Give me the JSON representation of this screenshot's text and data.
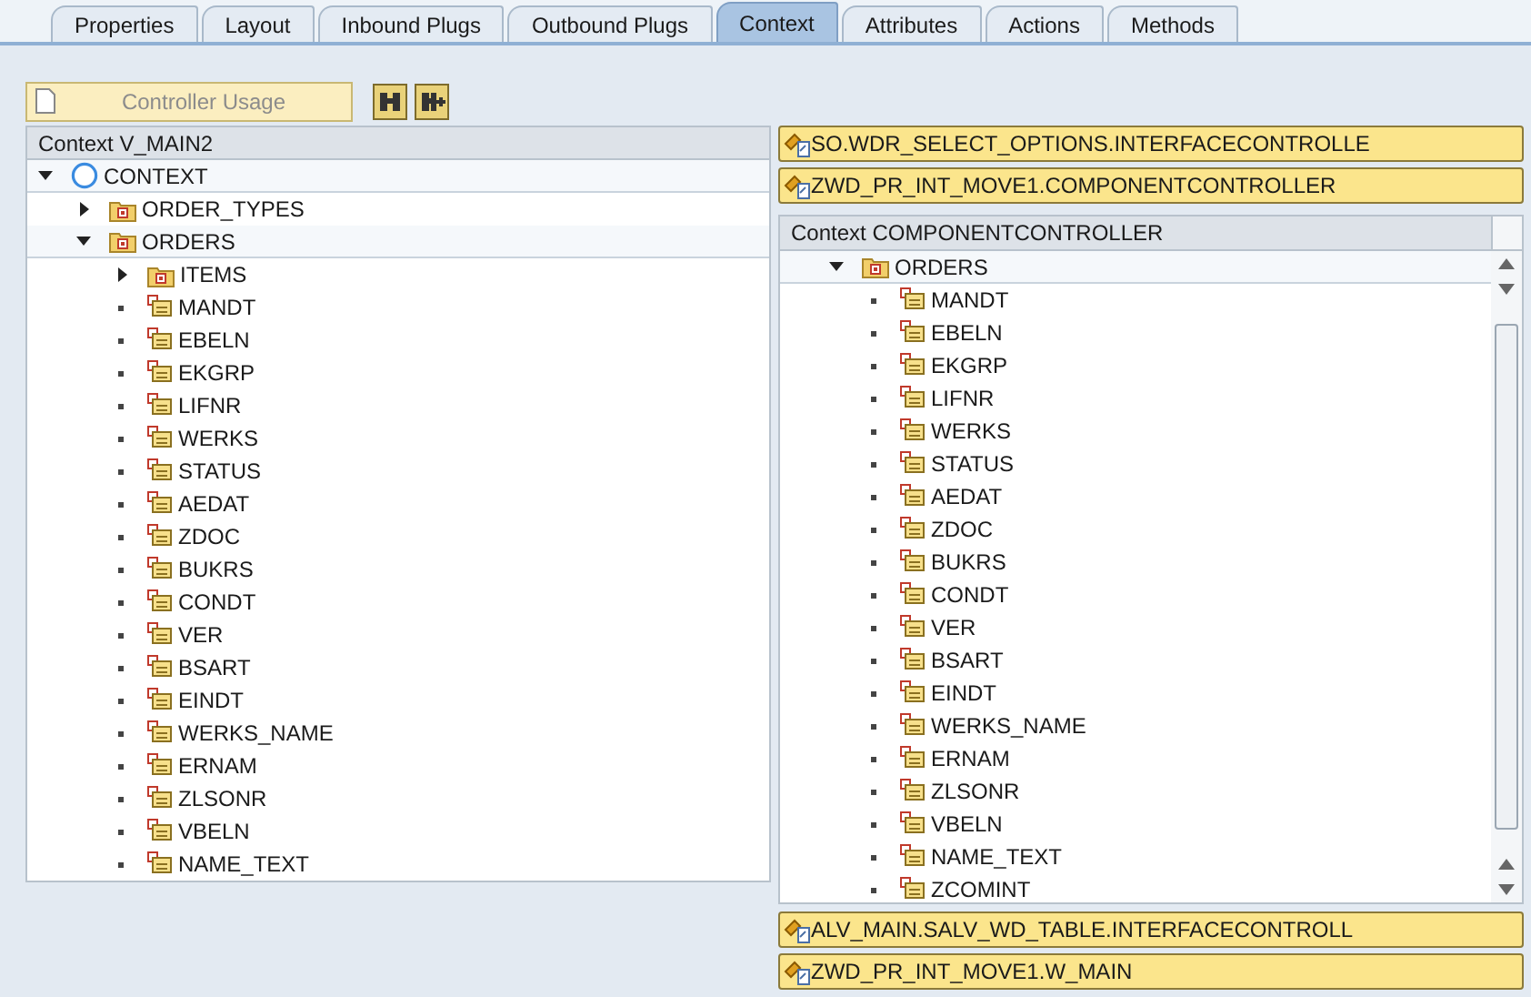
{
  "tabs": [
    {
      "label": "Properties",
      "selected": false
    },
    {
      "label": "Layout",
      "selected": false
    },
    {
      "label": "Inbound Plugs",
      "selected": false
    },
    {
      "label": "Outbound Plugs",
      "selected": false
    },
    {
      "label": "Context",
      "selected": true
    },
    {
      "label": "Attributes",
      "selected": false
    },
    {
      "label": "Actions",
      "selected": false
    },
    {
      "label": "Methods",
      "selected": false
    }
  ],
  "toolbar": {
    "controller_usage": {
      "label": "Controller Usage",
      "disabled": true
    }
  },
  "view_context": {
    "title": "Context V_MAIN2",
    "tree": [
      {
        "label": "CONTEXT",
        "kind": "root",
        "expanded": true,
        "children": [
          {
            "label": "ORDER_TYPES",
            "kind": "node",
            "expanded": false
          },
          {
            "label": "ORDERS",
            "kind": "node",
            "expanded": true,
            "children": [
              {
                "label": "ITEMS",
                "kind": "node",
                "expanded": false
              },
              {
                "label": "MANDT",
                "kind": "attribute"
              },
              {
                "label": "EBELN",
                "kind": "attribute"
              },
              {
                "label": "EKGRP",
                "kind": "attribute"
              },
              {
                "label": "LIFNR",
                "kind": "attribute"
              },
              {
                "label": "WERKS",
                "kind": "attribute"
              },
              {
                "label": "STATUS",
                "kind": "attribute"
              },
              {
                "label": "AEDAT",
                "kind": "attribute"
              },
              {
                "label": "ZDOC",
                "kind": "attribute"
              },
              {
                "label": "BUKRS",
                "kind": "attribute"
              },
              {
                "label": "CONDT",
                "kind": "attribute"
              },
              {
                "label": "VER",
                "kind": "attribute"
              },
              {
                "label": "BSART",
                "kind": "attribute"
              },
              {
                "label": "EINDT",
                "kind": "attribute"
              },
              {
                "label": "WERKS_NAME",
                "kind": "attribute"
              },
              {
                "label": "ERNAM",
                "kind": "attribute"
              },
              {
                "label": "ZLSONR",
                "kind": "attribute"
              },
              {
                "label": "VBELN",
                "kind": "attribute"
              },
              {
                "label": "NAME_TEXT",
                "kind": "attribute"
              }
            ]
          }
        ]
      }
    ]
  },
  "controllers_top": [
    "SO.WDR_SELECT_OPTIONS.INTERFACECONTROLLE",
    "ZWD_PR_INT_MOVE1.COMPONENTCONTROLLER"
  ],
  "component_context": {
    "title": "Context COMPONENTCONTROLLER",
    "tree": [
      {
        "label": "ORDERS",
        "kind": "node",
        "expanded": true,
        "children": [
          {
            "label": "MANDT",
            "kind": "attribute"
          },
          {
            "label": "EBELN",
            "kind": "attribute"
          },
          {
            "label": "EKGRP",
            "kind": "attribute"
          },
          {
            "label": "LIFNR",
            "kind": "attribute"
          },
          {
            "label": "WERKS",
            "kind": "attribute"
          },
          {
            "label": "STATUS",
            "kind": "attribute"
          },
          {
            "label": "AEDAT",
            "kind": "attribute"
          },
          {
            "label": "ZDOC",
            "kind": "attribute"
          },
          {
            "label": "BUKRS",
            "kind": "attribute"
          },
          {
            "label": "CONDT",
            "kind": "attribute"
          },
          {
            "label": "VER",
            "kind": "attribute"
          },
          {
            "label": "BSART",
            "kind": "attribute"
          },
          {
            "label": "EINDT",
            "kind": "attribute"
          },
          {
            "label": "WERKS_NAME",
            "kind": "attribute"
          },
          {
            "label": "ERNAM",
            "kind": "attribute"
          },
          {
            "label": "ZLSONR",
            "kind": "attribute"
          },
          {
            "label": "VBELN",
            "kind": "attribute"
          },
          {
            "label": "NAME_TEXT",
            "kind": "attribute"
          },
          {
            "label": "ZCOMINT",
            "kind": "attribute"
          }
        ]
      }
    ]
  },
  "controllers_bottom": [
    "ALV_MAIN.SALV_WD_TABLE.INTERFACECONTROLL",
    "ZWD_PR_INT_MOVE1.W_MAIN"
  ]
}
